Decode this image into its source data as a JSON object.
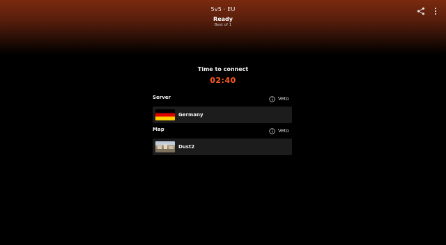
{
  "header": {
    "title": "5v5 · EU",
    "status": "Ready",
    "best_of": "Best of 1",
    "share_icon": "share-icon",
    "more_icon": "more-vertical-icon"
  },
  "connect": {
    "label": "Time to connect",
    "timer": "02:40"
  },
  "server": {
    "label": "Server",
    "veto_label": "Veto",
    "name": "Germany",
    "flag": "germany-flag"
  },
  "map": {
    "label": "Map",
    "veto_label": "Veto",
    "name": "Dust2",
    "thumbnail": "dust2-map-thumbnail"
  },
  "colors": {
    "accent": "#ff5a1f",
    "card": "#1c1c1c",
    "background": "#000000"
  }
}
